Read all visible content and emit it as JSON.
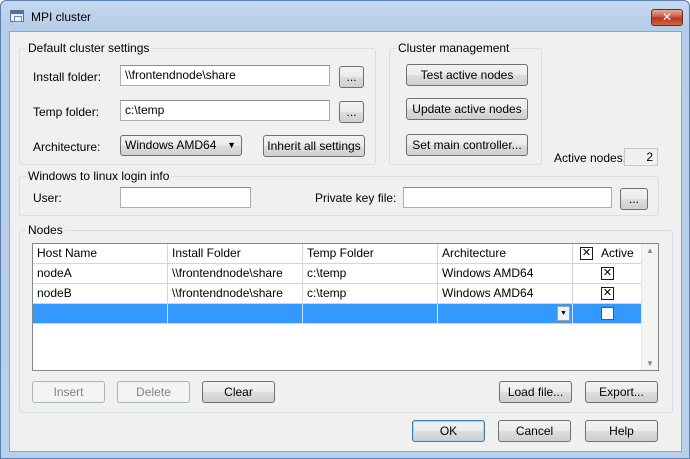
{
  "window": {
    "title": "MPI cluster",
    "close_label": "✕"
  },
  "default_settings": {
    "title": "Default cluster settings",
    "install_label": "Install folder:",
    "install_value": "\\\\frontendnode\\share",
    "temp_label": "Temp folder:",
    "temp_value": "c:\\temp",
    "arch_label": "Architecture:",
    "arch_value": "Windows AMD64",
    "browse_label": "...",
    "inherit_label": "Inherit all settings"
  },
  "cluster_mgmt": {
    "title": "Cluster management",
    "test_label": "Test active nodes",
    "update_label": "Update active nodes",
    "set_main_label": "Set main controller...",
    "active_nodes_label": "Active nodes:",
    "active_nodes_value": "2"
  },
  "login": {
    "title": "Windows to linux login info",
    "user_label": "User:",
    "user_value": "",
    "key_label": "Private key file:",
    "key_value": "",
    "browse_label": "..."
  },
  "nodes": {
    "title": "Nodes",
    "columns": [
      "Host Name",
      "Install Folder",
      "Temp Folder",
      "Architecture",
      "Active"
    ],
    "header_check": "✕",
    "rows": [
      {
        "host": "nodeA",
        "install": "\\\\frontendnode\\share",
        "temp": "c:\\temp",
        "arch": "Windows AMD64",
        "active": "✕"
      },
      {
        "host": "nodeB",
        "install": "\\\\frontendnode\\share",
        "temp": "c:\\temp",
        "arch": "Windows AMD64",
        "active": "✕"
      }
    ],
    "new_row_active": "",
    "insert_label": "Insert",
    "delete_label": "Delete",
    "clear_label": "Clear",
    "load_label": "Load file...",
    "export_label": "Export..."
  },
  "dialog": {
    "ok_label": "OK",
    "cancel_label": "Cancel",
    "help_label": "Help"
  },
  "colors": {
    "selection": "#3399ff",
    "title_gradient_top": "#c4d9ef",
    "close_red": "#c9503a"
  }
}
